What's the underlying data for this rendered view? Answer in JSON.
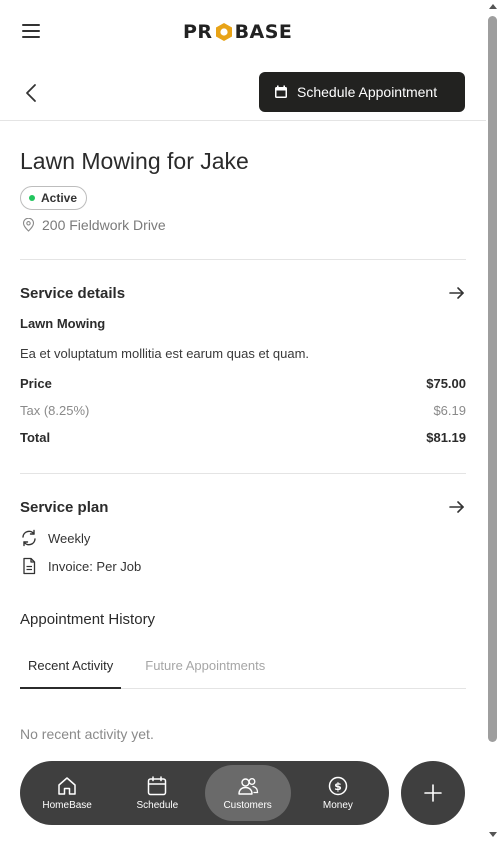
{
  "brand": {
    "logo_left": "PR",
    "logo_right": "BASE",
    "accent": "#e8a317"
  },
  "header": {
    "schedule_label": "Schedule Appointment"
  },
  "job": {
    "title": "Lawn Mowing for Jake",
    "status": "Active",
    "status_color": "#22c55e",
    "address": "200 Fieldwork Drive"
  },
  "service_details": {
    "title": "Service details",
    "name": "Lawn Mowing",
    "description": "Ea et voluptatum mollitia est earum quas et quam.",
    "price_label": "Price",
    "price_value": "$75.00",
    "tax_label": "Tax (8.25%)",
    "tax_value": "$6.19",
    "total_label": "Total",
    "total_value": "$81.19"
  },
  "service_plan": {
    "title": "Service plan",
    "frequency": "Weekly",
    "invoice": "Invoice: Per Job"
  },
  "history": {
    "title": "Appointment History",
    "tabs": [
      {
        "label": "Recent Activity",
        "active": true
      },
      {
        "label": "Future Appointments",
        "active": false
      }
    ],
    "empty_text": "No recent activity yet."
  },
  "nav": {
    "items": [
      {
        "label": "HomeBase",
        "icon": "home-icon",
        "active": false
      },
      {
        "label": "Schedule",
        "icon": "calendar-icon",
        "active": false
      },
      {
        "label": "Customers",
        "icon": "users-icon",
        "active": true
      },
      {
        "label": "Money",
        "icon": "dollar-icon",
        "active": false
      }
    ],
    "fab_icon": "plus-icon"
  }
}
